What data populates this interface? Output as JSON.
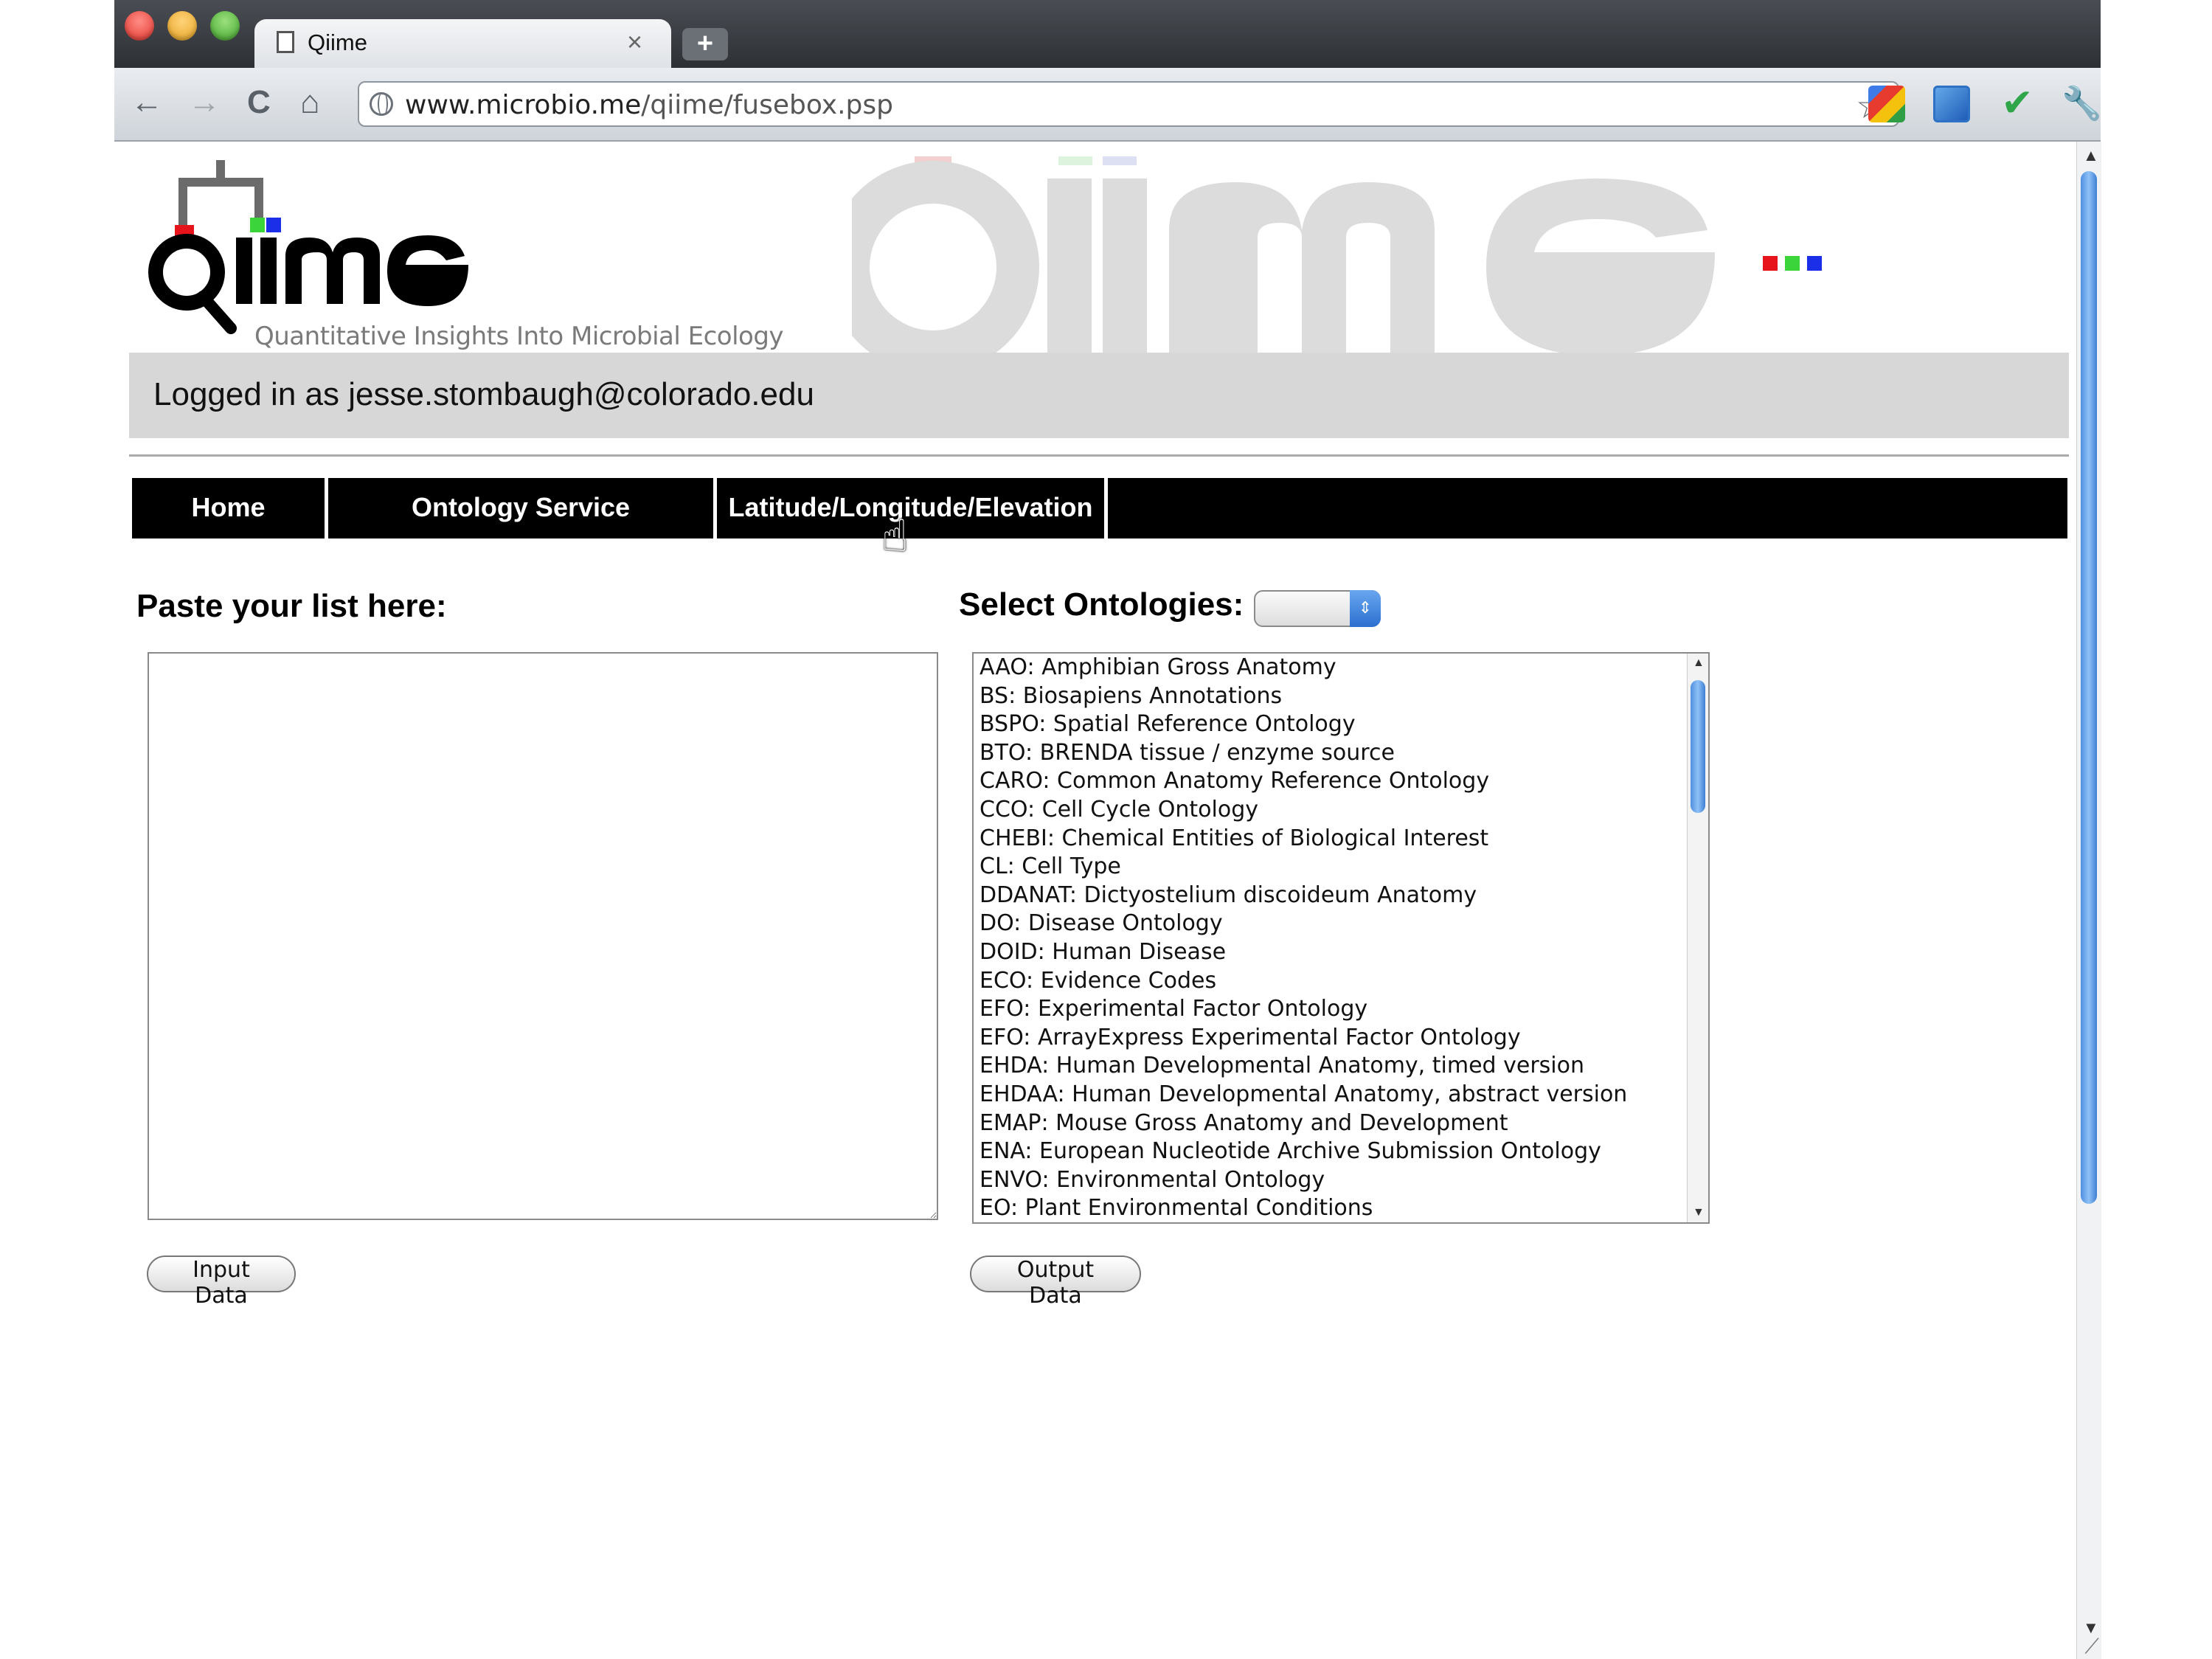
{
  "browser": {
    "tab_title": "Qiime",
    "tab_close": "×",
    "new_tab": "+",
    "url_host": "www.microbio.me",
    "url_path": "/qiime/fusebox.psp",
    "back": "←",
    "forward": "→",
    "reload": "C",
    "home": "⌂",
    "star": "☆",
    "check": "✔",
    "wrench": "🔧"
  },
  "header": {
    "logo_text": "qiime",
    "tagline": "Quantitative Insights Into Microbial Ecology",
    "logged_in": "Logged in as jesse.stombaugh@colorado.edu",
    "brand_colors": [
      "#e8141b",
      "#3bd43b",
      "#1b2fe8"
    ]
  },
  "nav": {
    "home": "Home",
    "ontology": "Ontology Service",
    "latlong": "Latitude/Longitude/Elevation"
  },
  "form": {
    "paste_label": "Paste your list here:",
    "paste_value": "",
    "select_label": "Select Ontologies:",
    "dropdown_value": "",
    "input_button": "Input Data",
    "output_button": "Output Data",
    "ontologies": [
      "AAO: Amphibian Gross Anatomy",
      "BS: Biosapiens Annotations",
      "BSPO: Spatial Reference Ontology",
      "BTO: BRENDA tissue / enzyme source",
      "CARO: Common Anatomy Reference Ontology",
      "CCO: Cell Cycle Ontology",
      "CHEBI: Chemical Entities of Biological Interest",
      "CL: Cell Type",
      "DDANAT: Dictyostelium discoideum Anatomy",
      "DO: Disease Ontology",
      "DOID: Human Disease",
      "ECO: Evidence Codes",
      "EFO: Experimental Factor Ontology",
      "EFO: ArrayExpress Experimental Factor Ontology",
      "EHDA: Human Developmental Anatomy, timed version",
      "EHDAA: Human Developmental Anatomy, abstract version",
      "EMAP: Mouse Gross Anatomy and Development",
      "ENA: European Nucleotide Archive Submission Ontology",
      "ENVO: Environmental Ontology",
      "EO: Plant Environmental Conditions"
    ]
  }
}
